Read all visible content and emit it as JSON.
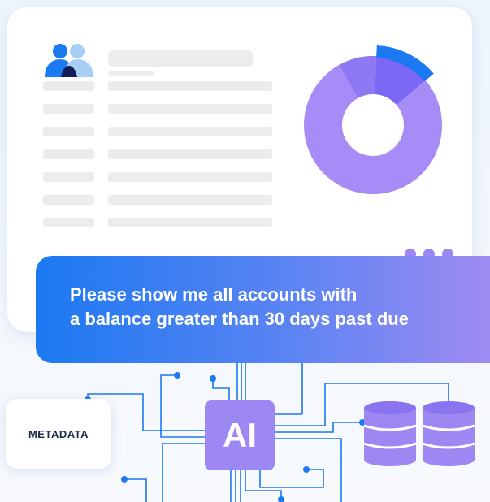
{
  "query": {
    "line1": "Please show me all accounts with",
    "line2": "a balance greater than 30 days past due"
  },
  "metadata_label": "METADATA",
  "ai_label": "AI",
  "colors": {
    "blue": "#1b79f1",
    "purple": "#9d87f2",
    "placeholder": "#ececef",
    "avatar_light": "#a7cff6",
    "avatar_dark": "#131d55"
  },
  "chart_data": {
    "type": "pie",
    "variant": "donut",
    "title": "",
    "slices": [
      {
        "value": 78,
        "color": "#a78bf6"
      },
      {
        "value": 9,
        "color": "#8f78f4"
      },
      {
        "value": 13,
        "color": "#7c68f6",
        "highlighted": true
      }
    ]
  }
}
